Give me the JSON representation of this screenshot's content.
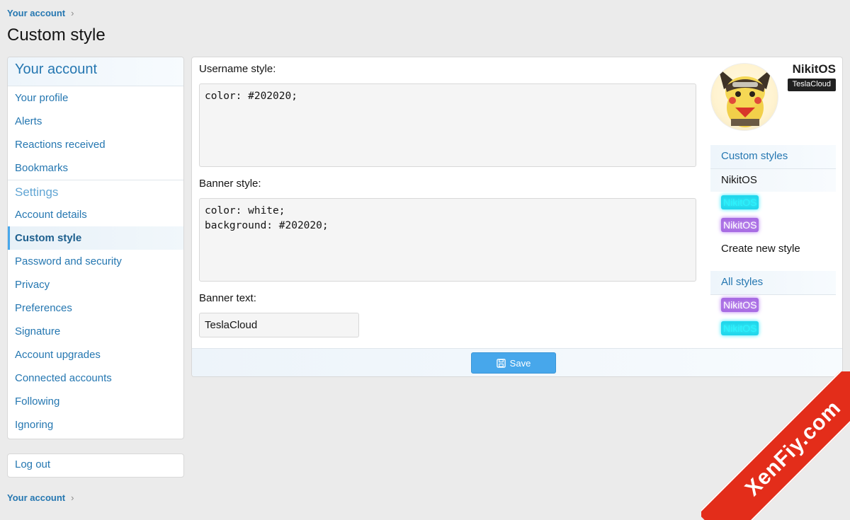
{
  "breadcrumb": {
    "label": "Your account"
  },
  "page_title": "Custom style",
  "sidebar": {
    "header": "Your account",
    "items": [
      {
        "label": "Your profile"
      },
      {
        "label": "Alerts"
      },
      {
        "label": "Reactions received"
      },
      {
        "label": "Bookmarks"
      }
    ],
    "settings_header": "Settings",
    "settings_items": [
      {
        "label": "Account details"
      },
      {
        "label": "Custom style"
      },
      {
        "label": "Password and security"
      },
      {
        "label": "Privacy"
      },
      {
        "label": "Preferences"
      },
      {
        "label": "Signature"
      },
      {
        "label": "Account upgrades"
      },
      {
        "label": "Connected accounts"
      },
      {
        "label": "Following"
      },
      {
        "label": "Ignoring"
      }
    ],
    "logout": "Log out"
  },
  "form": {
    "username_style_label": "Username style:",
    "username_style_value": "color: #202020;",
    "banner_style_label": "Banner style:",
    "banner_style_value": "color: white;\nbackground: #202020;",
    "banner_text_label": "Banner text:",
    "banner_text_value": "TeslaCloud",
    "save_label": "Save"
  },
  "preview": {
    "username": "NikitOS",
    "banner": "TeslaCloud",
    "avatar_icon": "pikachu-avatar-icon"
  },
  "custom_styles": {
    "header": "Custom styles",
    "items": [
      "NikitOS",
      "NikitOS",
      "NikitOS"
    ],
    "create_label": "Create new style"
  },
  "all_styles": {
    "header": "All styles",
    "items": [
      "NikitOS",
      "NikitOS"
    ]
  },
  "watermark": "XenFiy.com",
  "colors": {
    "link": "#2577b1",
    "accent": "#47a7eb",
    "banner_bg": "#202020",
    "ribbon": "#e32d1a"
  }
}
